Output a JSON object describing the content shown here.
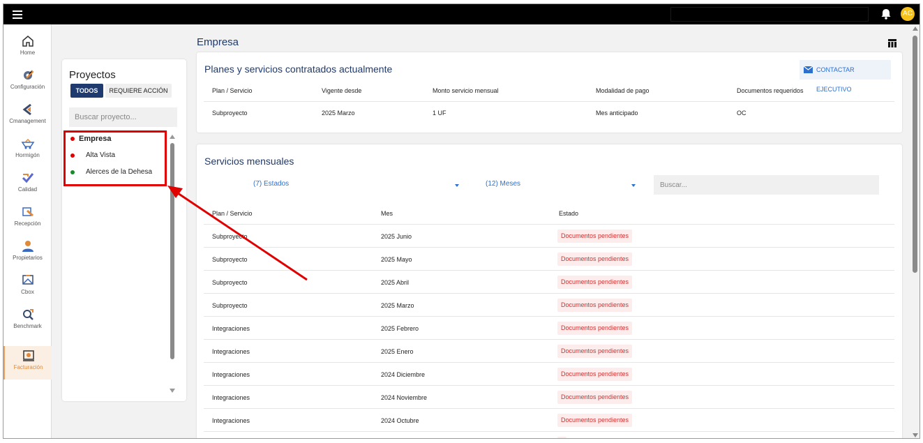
{
  "topbar": {
    "menu_icon": "hamburger-icon",
    "bell_icon": "bell-icon",
    "avatar_initials": "AC",
    "accent_color": "#f4c21a"
  },
  "sidebar": {
    "items": [
      {
        "label": "Home",
        "icon": "home-icon"
      },
      {
        "label": "Configuración",
        "icon": "gear-icon"
      },
      {
        "label": "Cmanagement",
        "icon": "cmanagement-icon"
      },
      {
        "label": "Hormigón",
        "icon": "concrete-icon"
      },
      {
        "label": "Calidad",
        "icon": "quality-icon"
      },
      {
        "label": "Recepción",
        "icon": "reception-icon"
      },
      {
        "label": "Propietarios",
        "icon": "owners-icon"
      },
      {
        "label": "Cbox",
        "icon": "cbox-icon"
      },
      {
        "label": "Benchmark",
        "icon": "benchmark-icon"
      },
      {
        "label": "Facturación",
        "icon": "billing-icon",
        "active": true
      }
    ]
  },
  "projects": {
    "title": "Proyectos",
    "tab_all": "TODOS",
    "tab_action": "REQUIERE ACCIÓN",
    "search_placeholder": "Buscar proyecto...",
    "items": [
      {
        "name": "Empresa",
        "status_color": "#e00000",
        "selected": true
      },
      {
        "name": "Alta Vista",
        "status_color": "#e00000"
      },
      {
        "name": "Alerces de la Dehesa",
        "status_color": "#1a8a2a"
      }
    ]
  },
  "main": {
    "title": "Empresa",
    "table_icon": "table-view-icon"
  },
  "plans": {
    "title": "Planes y servicios contratados actualmente",
    "contact_label": "CONTACTAR EJECUTIVO",
    "contact_icon": "mail-icon",
    "headers": [
      "Plan / Servicio",
      "Vigente desde",
      "Monto servicio mensual",
      "Modalidad de pago",
      "Documentos requeridos"
    ],
    "rows": [
      [
        "Subproyecto",
        "2025 Marzo",
        "1 UF",
        "Mes anticipado",
        "OC"
      ]
    ]
  },
  "monthly": {
    "title": "Servicios mensuales",
    "filter_states": "(7) Estados",
    "filter_months": "(12) Meses",
    "search_placeholder": "Buscar...",
    "headers": [
      "Plan / Servicio",
      "Mes",
      "Estado"
    ],
    "rows": [
      {
        "service": "Subproyecto",
        "month": "2025 Junio",
        "status": "Documentos pendientes"
      },
      {
        "service": "Subproyecto",
        "month": "2025 Mayo",
        "status": "Documentos pendientes"
      },
      {
        "service": "Subproyecto",
        "month": "2025 Abril",
        "status": "Documentos pendientes"
      },
      {
        "service": "Subproyecto",
        "month": "2025 Marzo",
        "status": "Documentos pendientes"
      },
      {
        "service": "Integraciones",
        "month": "2025 Febrero",
        "status": "Documentos pendientes"
      },
      {
        "service": "Integraciones",
        "month": "2025 Enero",
        "status": "Documentos pendientes"
      },
      {
        "service": "Integraciones",
        "month": "2024 Diciembre",
        "status": "Documentos pendientes"
      },
      {
        "service": "Integraciones",
        "month": "2024 Noviembre",
        "status": "Documentos pendientes"
      },
      {
        "service": "Integraciones",
        "month": "2024 Octubre",
        "status": "Documentos pendientes"
      }
    ]
  },
  "colors": {
    "primary": "#1e3a6e",
    "link": "#2d6fcd",
    "annotation": "#e00000",
    "pending_text": "#d32f2f",
    "pending_bg": "#fdecec"
  }
}
